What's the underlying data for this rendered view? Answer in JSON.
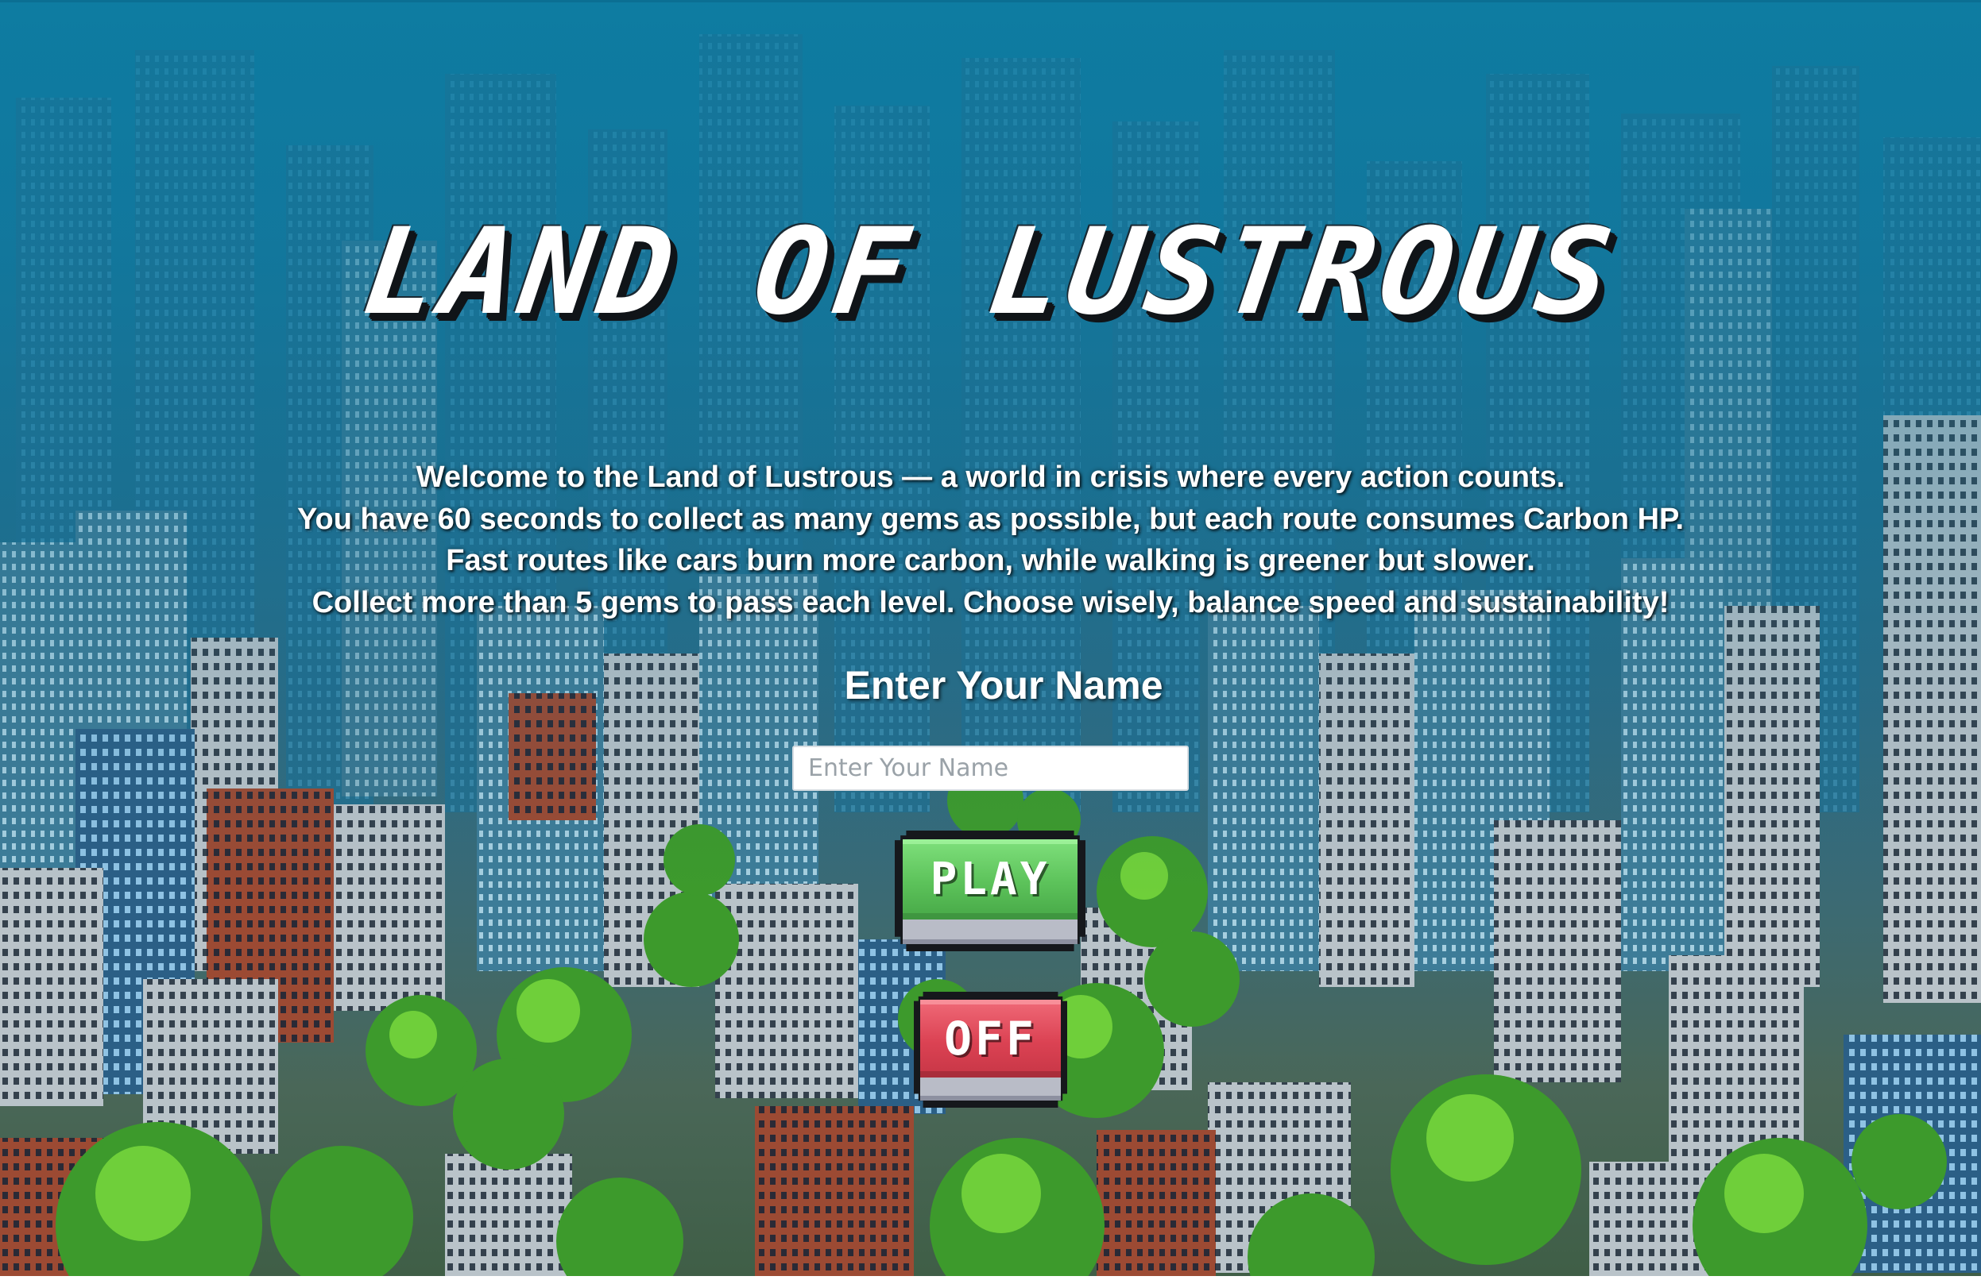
{
  "game": {
    "title": "LAND OF LUSTROUS",
    "intro_lines": [
      "Welcome to the Land of Lustrous — a world in crisis where every action counts.",
      "You have 60 seconds to collect as many gems as possible, but each route consumes Carbon HP.",
      "Fast routes like cars burn more carbon, while walking is greener but slower.",
      "Collect more than 5 gems to pass each level. Choose wisely, balance speed and sustainability!"
    ],
    "name_prompt": "Enter Your Name",
    "name_input": {
      "placeholder": "Enter Your Name",
      "value": ""
    },
    "play_label": "PLAY",
    "off_label": "OFF"
  },
  "colors": {
    "sky_top": "#0d7ea3",
    "play_green": "#5cc25a",
    "off_red": "#db4253",
    "title_shadow": "#101418"
  },
  "background": {
    "scene": "pixel-art city with skyscrapers and green trees"
  }
}
